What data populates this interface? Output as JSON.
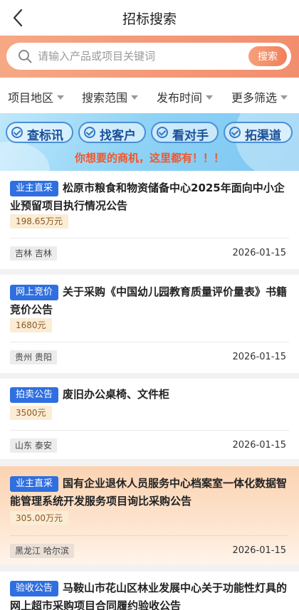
{
  "nav": {
    "title": "招标搜索",
    "back_icon": "chevron-left-icon"
  },
  "search": {
    "placeholder": "请输入产品或项目关键词",
    "value": "",
    "button_label": "搜索",
    "icon": "search-icon"
  },
  "filters": [
    {
      "label": "项目地区"
    },
    {
      "label": "搜索范围"
    },
    {
      "label": "发布时间"
    },
    {
      "label": "更多筛选"
    }
  ],
  "banner": {
    "pills": [
      {
        "label": "查标讯"
      },
      {
        "label": "找客户"
      },
      {
        "label": "看对手"
      },
      {
        "label": "拓渠道"
      }
    ],
    "slogan": "你想要的商机，这里都有！！！"
  },
  "listings": [
    {
      "tag": "业主直采",
      "title": "松原市粮食和物资储备中心2025年面向中小企业预留项目执行情况公告",
      "amount": "198.65万元",
      "region": "吉林 吉林",
      "date": "2026-01-15"
    },
    {
      "tag": "网上竞价",
      "title": "关于采购《中国幼儿园教育质量评价量表》书籍竞价公告",
      "amount": "1680元",
      "region": "贵州 贵阳",
      "date": "2026-01-15"
    },
    {
      "tag": "拍卖公告",
      "title": "废旧办公桌椅、文件柜",
      "amount": "3500元",
      "region": "山东 泰安",
      "date": "2026-01-15"
    },
    {
      "tag": "业主直采",
      "title": "国有企业退休人员服务中心档案室一体化数据智能管理系统开发服务项目询比采购公告",
      "amount": "305.00万元",
      "region": "黑龙江 哈尔滨",
      "date": "2026-01-15"
    },
    {
      "tag": "验收公告",
      "title": "马鞍山市花山区林业发展中心关于功能性灯具的网上超市采购项目合同履约验收公告"
    }
  ],
  "colors": {
    "accent": "#f0805a",
    "tag_blue": "#2f6fe0",
    "amount_bg": "#fbecd6"
  }
}
